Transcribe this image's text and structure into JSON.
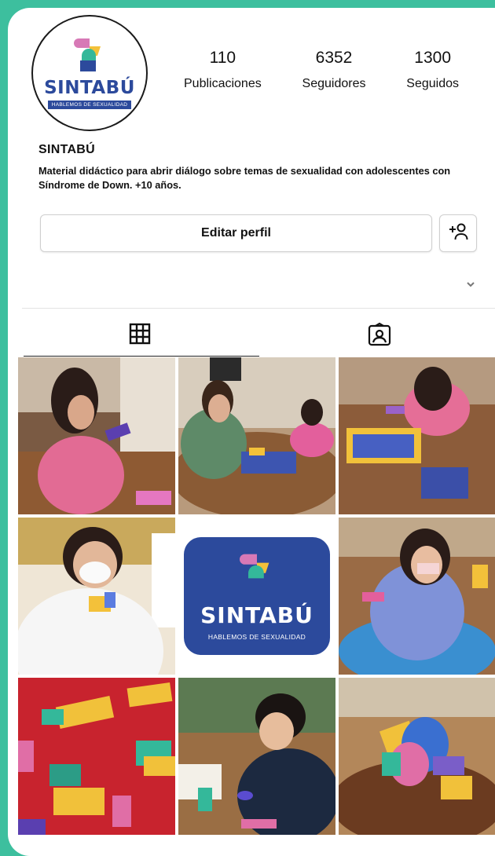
{
  "profile": {
    "logo_word": "SINTABÚ",
    "logo_tagline": "HABLEMOS DE SEXUALIDAD",
    "name": "SINTABÚ",
    "bio": "Material didáctico para abrir diálogo sobre temas de sexualidad con adolescentes con Síndrome de Down.  +10 años."
  },
  "stats": [
    {
      "value": "110",
      "label": "Publicaciones"
    },
    {
      "value": "6352",
      "label": "Seguidores"
    },
    {
      "value": "1300",
      "label": "Seguidos"
    }
  ],
  "actions": {
    "edit_label": "Editar perfil",
    "add_icon": "add-person-icon"
  },
  "tabs": [
    {
      "icon": "grid-icon",
      "active": true
    },
    {
      "icon": "tagged-icon",
      "active": false
    }
  ],
  "posts": [
    {
      "type": "photo"
    },
    {
      "type": "photo"
    },
    {
      "type": "photo"
    },
    {
      "type": "photo"
    },
    {
      "type": "logo",
      "word": "SINTABÚ",
      "tagline": "HABLEMOS DE SEXUALIDAD"
    },
    {
      "type": "photo"
    },
    {
      "type": "photo"
    },
    {
      "type": "photo"
    },
    {
      "type": "photo"
    }
  ],
  "colors": {
    "brand_blue": "#2c4a9c",
    "background_green": "#3dbf9e"
  }
}
